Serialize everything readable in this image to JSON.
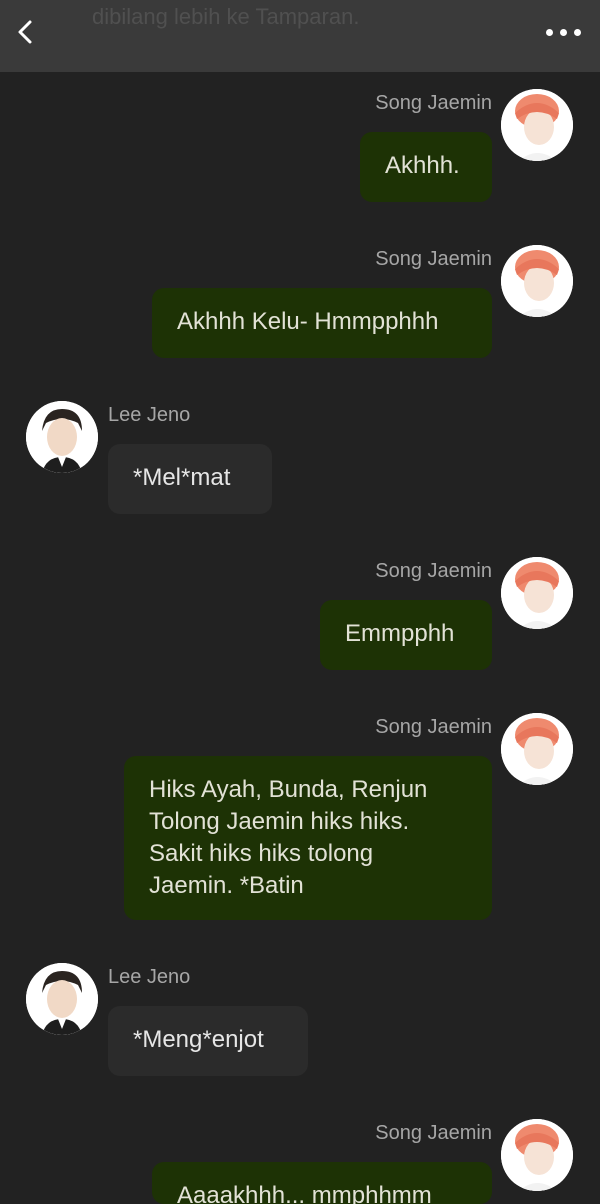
{
  "header": {
    "title": "dibilang lebih ke Tamparan.",
    "back_icon": "chevron-left-icon",
    "more_icon": "more-horizontal-icon"
  },
  "colors": {
    "background": "#222222",
    "header": "#3a3a3a",
    "outgoing_bubble": "#1d3205",
    "incoming_bubble": "#2b2b2b",
    "sender_name": "#a6a6a6"
  },
  "messages": [
    {
      "side": "right",
      "sender": "Song Jaemin",
      "text": "Akhhh."
    },
    {
      "side": "right",
      "sender": "Song Jaemin",
      "text": "Akhhh Kelu- Hmmpphhh"
    },
    {
      "side": "left",
      "sender": "Lee Jeno",
      "text": "*Mel*mat"
    },
    {
      "side": "right",
      "sender": "Song Jaemin",
      "text": "Emmpphh"
    },
    {
      "side": "right",
      "sender": "Song Jaemin",
      "text": "Hiks Ayah, Bunda, Renjun\nTolong Jaemin hiks hiks.\nSakit hiks hiks tolong\nJaemin. *Batin"
    },
    {
      "side": "left",
      "sender": "Lee Jeno",
      "text": "*Meng*enjot"
    },
    {
      "side": "right",
      "sender": "Song Jaemin",
      "text": "Aaaakhhh... mmphhmm"
    }
  ]
}
